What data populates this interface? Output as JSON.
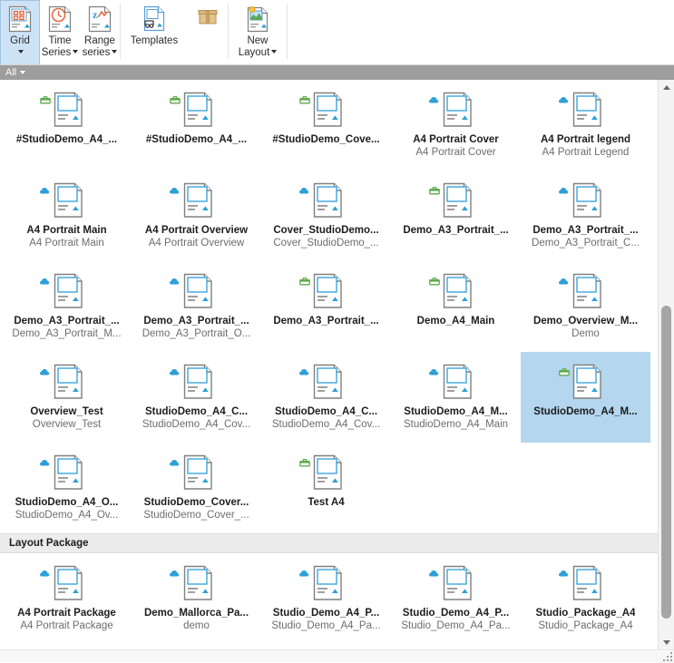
{
  "ribbon": {
    "buttons": [
      {
        "name": "grid",
        "icon": "grid-layout-icon",
        "lines": [
          "Grid"
        ],
        "caret": true,
        "selected": true,
        "width": "narrow"
      },
      {
        "name": "time-series",
        "icon": "clock-document-icon",
        "lines": [
          "Time",
          "Series"
        ],
        "caret": "inline",
        "selected": false,
        "width": "narrow"
      },
      {
        "name": "range-series",
        "icon": "z-range-document-icon",
        "lines": [
          "Range",
          "series"
        ],
        "caret": "inline",
        "selected": false,
        "width": "narrow"
      },
      {
        "name": "templates",
        "icon": "templates-document-icon",
        "lines": [
          "Templates"
        ],
        "caret": false,
        "selected": false,
        "width": "xwide"
      },
      {
        "name": "package",
        "icon": "package-box-icon",
        "lines": [
          ""
        ],
        "caret": false,
        "selected": false,
        "width": "narrow"
      },
      {
        "name": "new-layout",
        "icon": "new-layout-icon",
        "lines": [
          "New",
          "Layout"
        ],
        "caret": "inline",
        "selected": false,
        "width": "wide"
      }
    ]
  },
  "filter": {
    "label": "All"
  },
  "gallery": {
    "groups": [
      {
        "header": null,
        "rows": [
          [
            {
              "title": "#StudioDemo_A4_...",
              "subtitle": "",
              "badge": "package",
              "selected": false
            },
            {
              "title": "#StudioDemo_A4_...",
              "subtitle": "",
              "badge": "package",
              "selected": false
            },
            {
              "title": "#StudioDemo_Cove...",
              "subtitle": "",
              "badge": "package",
              "selected": false
            },
            {
              "title": "A4 Portrait Cover",
              "subtitle": "A4 Portrait Cover",
              "badge": "cloud",
              "selected": false
            },
            {
              "title": "A4 Portrait legend",
              "subtitle": "A4 Portrait Legend",
              "badge": "cloud",
              "selected": false
            }
          ],
          [
            {
              "title": "A4 Portrait Main",
              "subtitle": "A4 Portrait Main",
              "badge": "cloud",
              "selected": false
            },
            {
              "title": "A4 Portrait Overview",
              "subtitle": "A4 Portrait Overview",
              "badge": "cloud",
              "selected": false
            },
            {
              "title": "Cover_StudioDemo...",
              "subtitle": "Cover_StudioDemo_...",
              "badge": "cloud",
              "selected": false
            },
            {
              "title": "Demo_A3_Portrait_...",
              "subtitle": "",
              "badge": "package",
              "selected": false
            },
            {
              "title": "Demo_A3_Portrait_...",
              "subtitle": "Demo_A3_Portrait_C...",
              "badge": "cloud",
              "selected": false
            }
          ],
          [
            {
              "title": "Demo_A3_Portrait_...",
              "subtitle": "Demo_A3_Portrait_M...",
              "badge": "cloud",
              "selected": false
            },
            {
              "title": "Demo_A3_Portrait_...",
              "subtitle": "Demo_A3_Portrait_O...",
              "badge": "cloud",
              "selected": false
            },
            {
              "title": "Demo_A3_Portrait_...",
              "subtitle": "",
              "badge": "package",
              "selected": false
            },
            {
              "title": "Demo_A4_Main",
              "subtitle": "",
              "badge": "package",
              "selected": false
            },
            {
              "title": "Demo_Overview_M...",
              "subtitle": "Demo",
              "badge": "cloud",
              "selected": false
            }
          ],
          [
            {
              "title": "Overview_Test",
              "subtitle": "Overview_Test",
              "badge": "cloud",
              "selected": false
            },
            {
              "title": "StudioDemo_A4_C...",
              "subtitle": "StudioDemo_A4_Cov...",
              "badge": "cloud",
              "selected": false
            },
            {
              "title": "StudioDemo_A4_C...",
              "subtitle": "StudioDemo_A4_Cov...",
              "badge": "cloud",
              "selected": false
            },
            {
              "title": "StudioDemo_A4_M...",
              "subtitle": "StudioDemo_A4_Main",
              "badge": "cloud",
              "selected": false
            },
            {
              "title": "StudioDemo_A4_M...",
              "subtitle": "",
              "badge": "package",
              "selected": true
            }
          ],
          [
            {
              "title": "StudioDemo_A4_O...",
              "subtitle": "StudioDemo_A4_Ov...",
              "badge": "cloud",
              "selected": false
            },
            {
              "title": "StudioDemo_Cover...",
              "subtitle": "StudioDemo_Cover_...",
              "badge": "cloud",
              "selected": false
            },
            {
              "title": "Test A4",
              "subtitle": "",
              "badge": "package",
              "selected": false
            },
            {
              "title": "",
              "subtitle": "",
              "badge": "none",
              "selected": false
            },
            {
              "title": "",
              "subtitle": "",
              "badge": "none",
              "selected": false
            }
          ]
        ]
      },
      {
        "header": "Layout Package",
        "rows": [
          [
            {
              "title": "A4 Portrait Package",
              "subtitle": "A4 Portrait Package",
              "badge": "cloud",
              "selected": false
            },
            {
              "title": "Demo_Mallorca_Pa...",
              "subtitle": "demo",
              "badge": "cloud",
              "selected": false
            },
            {
              "title": "Studio_Demo_A4_P...",
              "subtitle": "Studio_Demo_A4_Pa...",
              "badge": "cloud",
              "selected": false
            },
            {
              "title": "Studio_Demo_A4_P...",
              "subtitle": "Studio_Demo_A4_Pa...",
              "badge": "cloud",
              "selected": false
            },
            {
              "title": "Studio_Package_A4",
              "subtitle": "Studio_Package_A4",
              "badge": "cloud",
              "selected": false
            }
          ]
        ]
      }
    ]
  },
  "scrollbar": {
    "up_icon": "chevron-up-icon",
    "down_icon": "chevron-down-icon",
    "thumb_top_pct": 39,
    "thumb_height_pct": 58
  },
  "colors": {
    "selection": "#b4d6ee",
    "ribbon_selected": "#cde3f5",
    "filter_bar": "#9d9d9d",
    "group_header": "#ececec",
    "badge_cloud": "#2e9fd9",
    "badge_package": "#5faa4e",
    "doc_outline": "#808080",
    "doc_accent": "#2e9fd9"
  }
}
